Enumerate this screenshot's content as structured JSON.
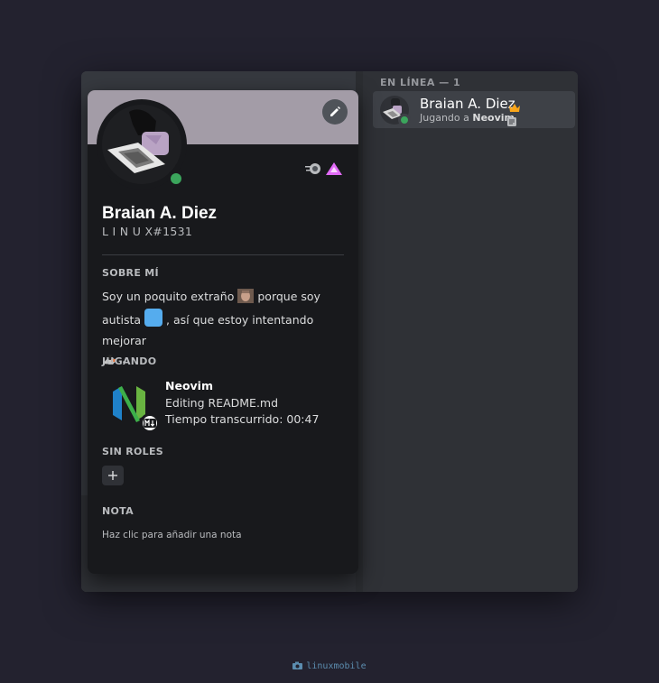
{
  "member_list": {
    "section_header": "EN LÍNEA — 1",
    "members": [
      {
        "name": "Braian A. Diez",
        "activity_prefix": "Jugando a",
        "activity_game": "Neovim",
        "status": "online"
      }
    ]
  },
  "profile": {
    "display_name": "Braian A. Diez",
    "username": "L I N U X#1531",
    "about_title": "SOBRE MÍ",
    "about_part1": "Soy un poquito extraño",
    "about_part2": "porque soy autista",
    "about_part3": ", así que estoy intentando mejorar",
    "about_part4": ".",
    "playing_title": "JUGANDO",
    "game": {
      "name": "Neovim",
      "details": "Editing README.md",
      "elapsed": "Tiempo transcurrido: 00:47"
    },
    "roles_title": "SIN ROLES",
    "note_title": "NOTA",
    "note_placeholder": "Haz clic para añadir una nota"
  },
  "footer": {
    "label": "linuxmobile"
  },
  "colors": {
    "background": "#23222f",
    "banner": "#a39ca7",
    "online": "#3ba55c",
    "popout": "#18191c"
  },
  "icons": [
    "pencil-icon",
    "crown-icon",
    "rich-presence-icon",
    "plus-icon",
    "camera-icon",
    "markdown-icon",
    "neovim-logo",
    "nitro-badge",
    "hypesquad-badge"
  ]
}
